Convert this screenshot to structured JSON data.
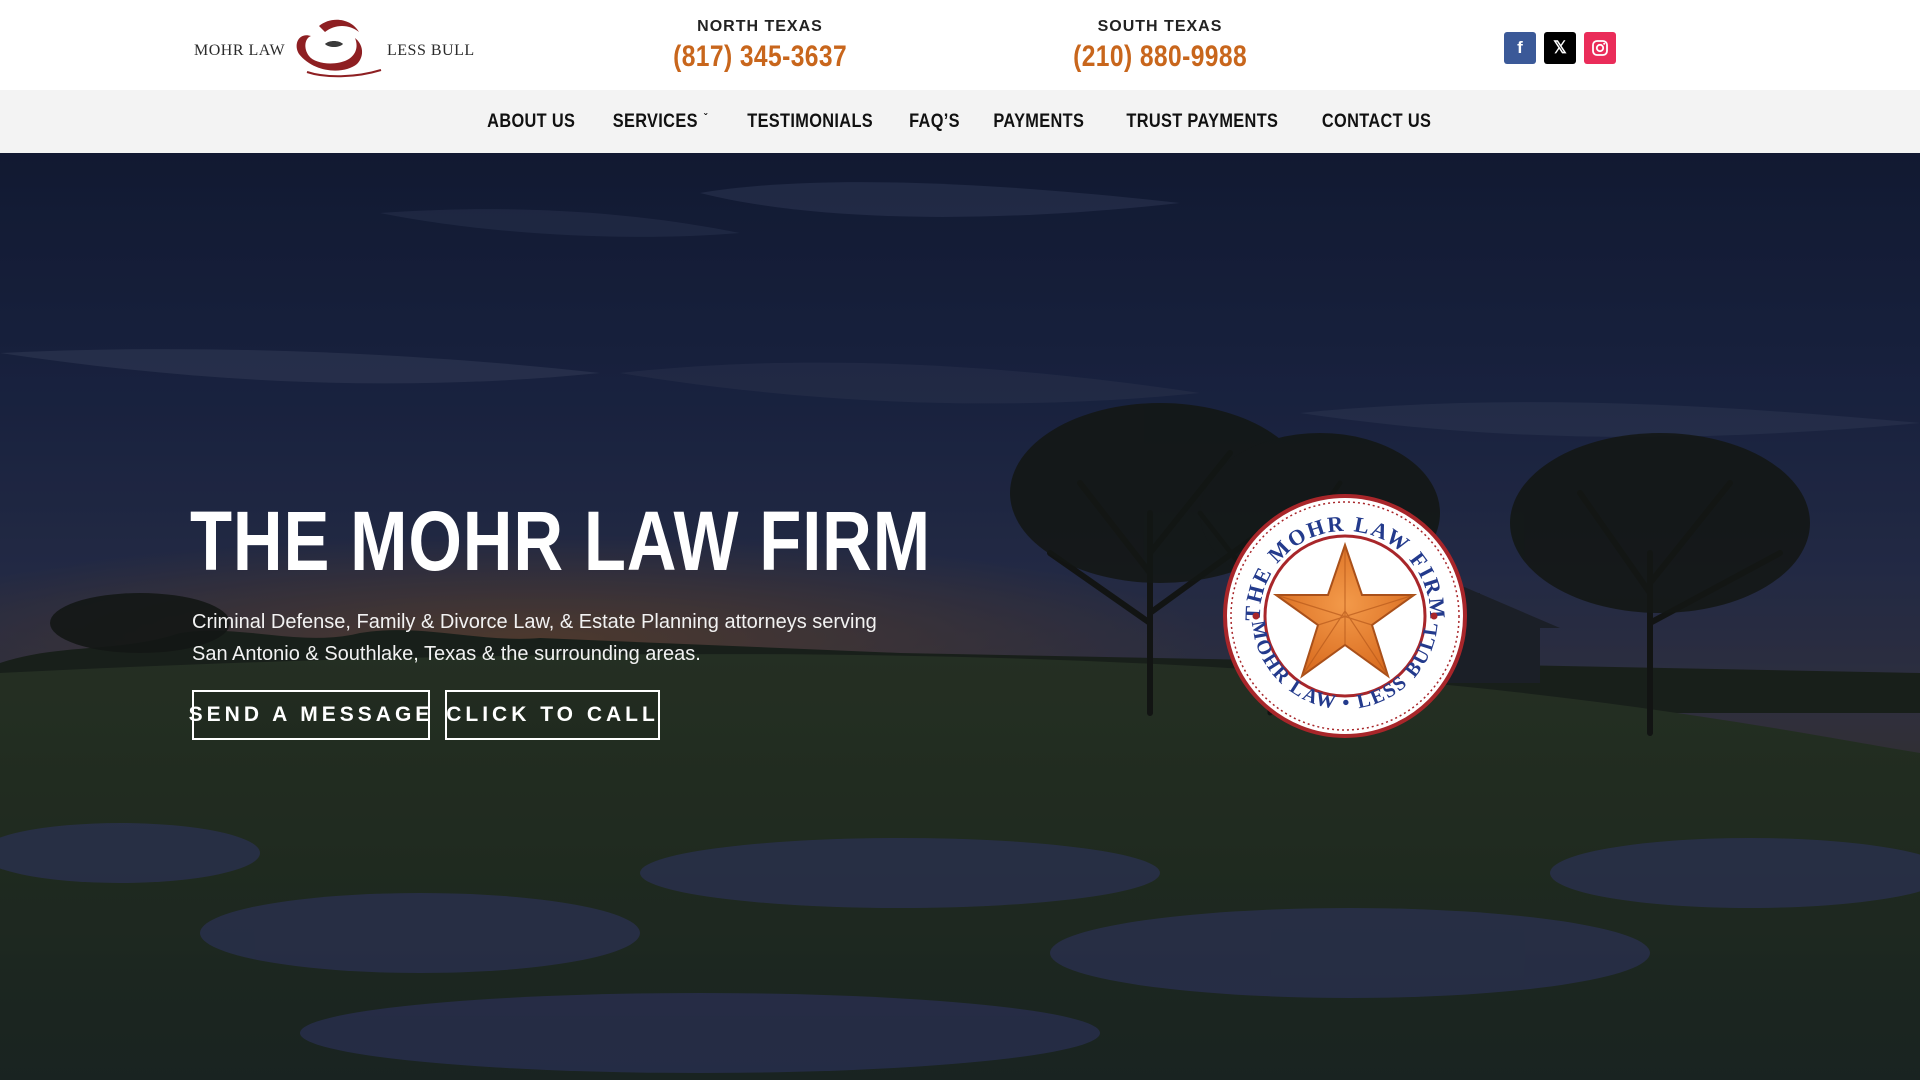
{
  "header": {
    "logo": {
      "left_text": "MOHR LAW",
      "right_text": "LESS BULL"
    },
    "phones": [
      {
        "region": "NORTH TEXAS",
        "number": "(817) 345-3637"
      },
      {
        "region": "SOUTH TEXAS",
        "number": "(210) 880-9988"
      }
    ],
    "social": [
      {
        "name": "facebook-icon",
        "glyph": "f",
        "color": "#3b5998"
      },
      {
        "name": "x-icon",
        "glyph": "𝕏",
        "color": "#000000"
      },
      {
        "name": "instagram-icon",
        "glyph": "◎",
        "color": "#ea2c59"
      }
    ]
  },
  "nav": {
    "items": [
      {
        "label": "ABOUT US"
      },
      {
        "label": "SERVICES",
        "has_dropdown": true
      },
      {
        "label": "TESTIMONIALS"
      },
      {
        "label": "FAQ’S"
      },
      {
        "label": "PAYMENTS"
      },
      {
        "label": "TRUST PAYMENTS"
      },
      {
        "label": "CONTACT US"
      }
    ]
  },
  "hero": {
    "title": "THE MOHR LAW FIRM",
    "subtitle_line1": "Criminal Defense, Family & Divorce Law, & Estate Planning attorneys serving",
    "subtitle_line2": "San Antonio & Southlake, Texas & the surrounding areas.",
    "buttons": {
      "message": "SEND A MESSAGE",
      "call": "CLICK TO CALL"
    },
    "seal": {
      "top_text": "THE MOHR LAW FIRM",
      "bottom_text": "MOHR LAW • LESS BULL"
    }
  },
  "colors": {
    "accent_orange": "#c8661c",
    "seal_red": "#a8262a",
    "seal_blue": "#233a8c"
  }
}
